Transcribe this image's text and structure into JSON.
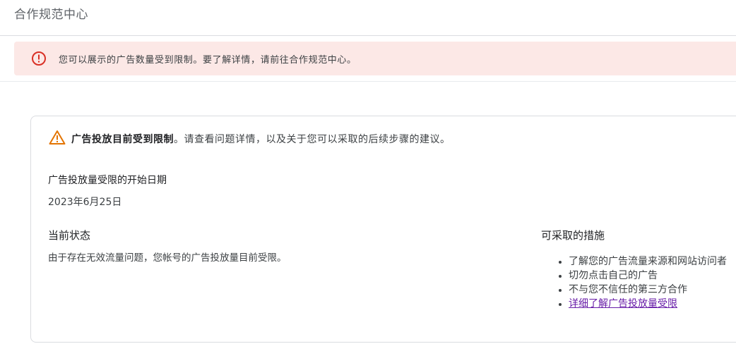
{
  "header": {
    "title": "合作规范中心"
  },
  "alert": {
    "text": "您可以展示的广告数量受到限制。要了解详情，请前往合作规范中心。",
    "color": "#d93025"
  },
  "card": {
    "warning_bold": "广告投放目前受到限制",
    "warning_text": "。请查看问题详情，以及关于您可以采取的后续步骤的建议。",
    "start_date_label": "广告投放量受限的开始日期",
    "start_date_value": "2023年6月25日",
    "status_label": "当前状态",
    "status_value": "由于存在无效流量问题，您帐号的广告投放量目前受限。",
    "actions_label": "可采取的措施",
    "actions": [
      "了解您的广告流量来源和网站访问者",
      "切勿点击自己的广告",
      "不与您不信任的第三方合作"
    ],
    "learn_more_link": "详细了解广告投放量受限",
    "warning_color": "#e37400",
    "link_color": "#681da8"
  }
}
